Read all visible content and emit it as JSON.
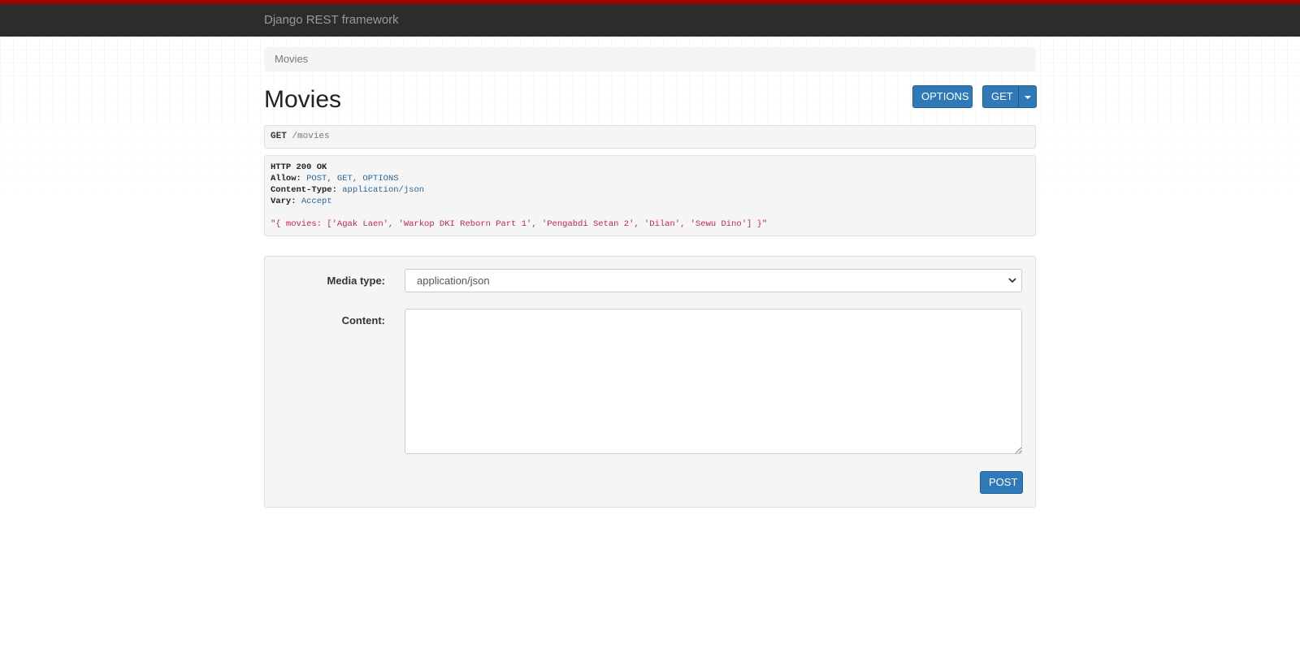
{
  "navbar": {
    "brand": "Django REST framework"
  },
  "breadcrumb": {
    "item": "Movies"
  },
  "header": {
    "title": "Movies",
    "options_label": "OPTIONS",
    "get_label": "GET"
  },
  "request": {
    "method": "GET",
    "path": "/movies"
  },
  "response": {
    "status": "HTTP 200 OK",
    "headers": [
      {
        "key": "Allow:",
        "value": "POST, GET, OPTIONS"
      },
      {
        "key": "Content-Type:",
        "value": "application/json"
      },
      {
        "key": "Vary:",
        "value": "Accept"
      }
    ],
    "body": "\"{ movies: ['Agak Laen', 'Warkop DKI Reborn Part 1', 'Pengabdi Setan 2', 'Dilan', 'Sewu Dino'] }\""
  },
  "form": {
    "media_type_label": "Media type:",
    "media_type_value": "application/json",
    "content_label": "Content:",
    "content_value": "",
    "post_label": "POST"
  },
  "colors": {
    "accent_red": "#a30000",
    "navbar": "#2c2c2c",
    "button": "#2f79b8",
    "string": "#c7254e"
  },
  "icons": {
    "caret": "caret-down-icon",
    "select_arrow": "chevron-down-icon",
    "resize": "resize-handle-icon"
  }
}
